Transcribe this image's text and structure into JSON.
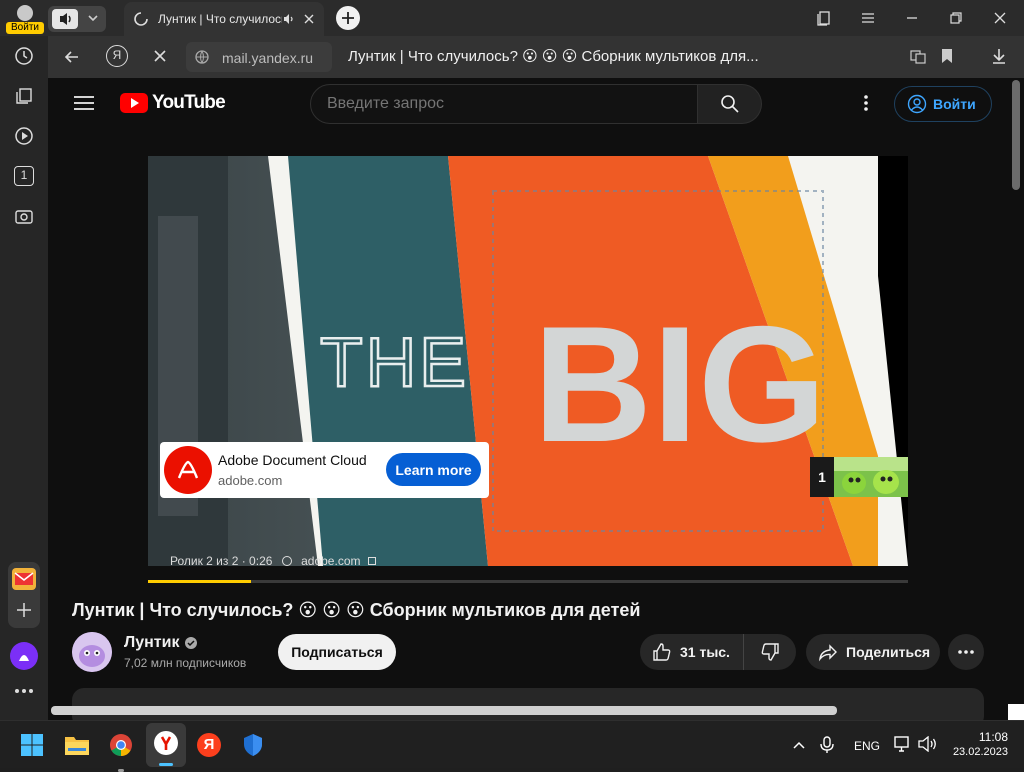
{
  "browser": {
    "profile_label": "Войти",
    "tab_title": "Лунтик | Что случилось?",
    "domain": "mail.yandex.ru",
    "page_title": "Лунтик | Что случилось? 😮 😮 😮 Сборник мультиков для...",
    "yandex_glyph": "Я",
    "sidebar_counter": "1",
    "accent_color": "#ffcc00"
  },
  "youtube": {
    "logo_text": "YouTube",
    "search_placeholder": "Введите запрос",
    "signin_label": "Войти",
    "ad": {
      "brand": "Adobe Document Cloud",
      "domain": "adobe.com",
      "cta": "Learn more",
      "info_text": "Ролик 2 из 2 · 0:26",
      "info_domain": "adobe.com",
      "big_text": "BIG",
      "the_text": "THE",
      "queue_number": "1",
      "progress_fraction": 0.135
    },
    "video_title": "Лунтик | Что случилось? 😮 😮 😮 Сборник мультиков для детей",
    "channel": {
      "name": "Лунтик",
      "subscribers": "7,02 млн подписчиков",
      "subscribe_label": "Подписаться"
    },
    "actions": {
      "likes": "31 тыс.",
      "share_label": "Поделиться"
    }
  },
  "taskbar": {
    "lang": "ENG",
    "time": "11:08",
    "date": "23.02.2023",
    "yandex_glyph": "Я"
  }
}
